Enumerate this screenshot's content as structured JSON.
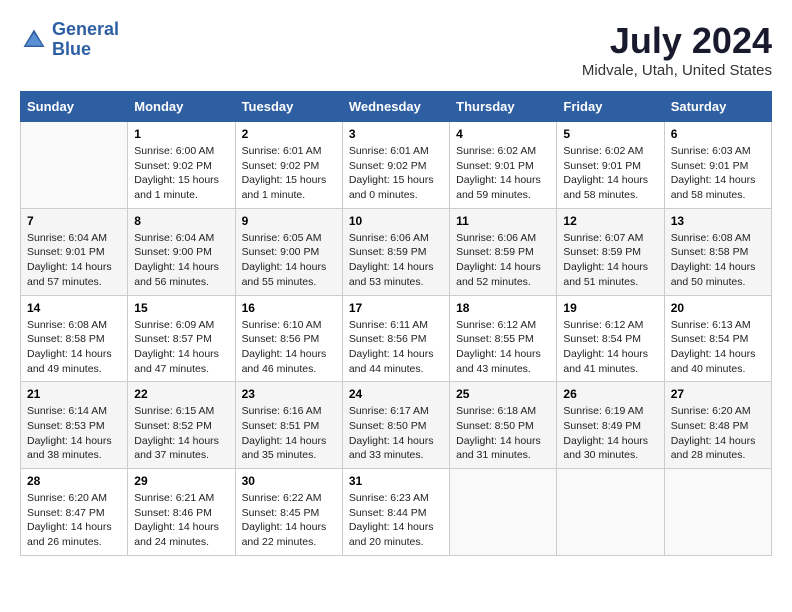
{
  "logo": {
    "line1": "General",
    "line2": "Blue"
  },
  "title": "July 2024",
  "subtitle": "Midvale, Utah, United States",
  "weekdays": [
    "Sunday",
    "Monday",
    "Tuesday",
    "Wednesday",
    "Thursday",
    "Friday",
    "Saturday"
  ],
  "weeks": [
    [
      {
        "day": "",
        "info": ""
      },
      {
        "day": "1",
        "info": "Sunrise: 6:00 AM\nSunset: 9:02 PM\nDaylight: 15 hours\nand 1 minute."
      },
      {
        "day": "2",
        "info": "Sunrise: 6:01 AM\nSunset: 9:02 PM\nDaylight: 15 hours\nand 1 minute."
      },
      {
        "day": "3",
        "info": "Sunrise: 6:01 AM\nSunset: 9:02 PM\nDaylight: 15 hours\nand 0 minutes."
      },
      {
        "day": "4",
        "info": "Sunrise: 6:02 AM\nSunset: 9:01 PM\nDaylight: 14 hours\nand 59 minutes."
      },
      {
        "day": "5",
        "info": "Sunrise: 6:02 AM\nSunset: 9:01 PM\nDaylight: 14 hours\nand 58 minutes."
      },
      {
        "day": "6",
        "info": "Sunrise: 6:03 AM\nSunset: 9:01 PM\nDaylight: 14 hours\nand 58 minutes."
      }
    ],
    [
      {
        "day": "7",
        "info": "Sunrise: 6:04 AM\nSunset: 9:01 PM\nDaylight: 14 hours\nand 57 minutes."
      },
      {
        "day": "8",
        "info": "Sunrise: 6:04 AM\nSunset: 9:00 PM\nDaylight: 14 hours\nand 56 minutes."
      },
      {
        "day": "9",
        "info": "Sunrise: 6:05 AM\nSunset: 9:00 PM\nDaylight: 14 hours\nand 55 minutes."
      },
      {
        "day": "10",
        "info": "Sunrise: 6:06 AM\nSunset: 8:59 PM\nDaylight: 14 hours\nand 53 minutes."
      },
      {
        "day": "11",
        "info": "Sunrise: 6:06 AM\nSunset: 8:59 PM\nDaylight: 14 hours\nand 52 minutes."
      },
      {
        "day": "12",
        "info": "Sunrise: 6:07 AM\nSunset: 8:59 PM\nDaylight: 14 hours\nand 51 minutes."
      },
      {
        "day": "13",
        "info": "Sunrise: 6:08 AM\nSunset: 8:58 PM\nDaylight: 14 hours\nand 50 minutes."
      }
    ],
    [
      {
        "day": "14",
        "info": "Sunrise: 6:08 AM\nSunset: 8:58 PM\nDaylight: 14 hours\nand 49 minutes."
      },
      {
        "day": "15",
        "info": "Sunrise: 6:09 AM\nSunset: 8:57 PM\nDaylight: 14 hours\nand 47 minutes."
      },
      {
        "day": "16",
        "info": "Sunrise: 6:10 AM\nSunset: 8:56 PM\nDaylight: 14 hours\nand 46 minutes."
      },
      {
        "day": "17",
        "info": "Sunrise: 6:11 AM\nSunset: 8:56 PM\nDaylight: 14 hours\nand 44 minutes."
      },
      {
        "day": "18",
        "info": "Sunrise: 6:12 AM\nSunset: 8:55 PM\nDaylight: 14 hours\nand 43 minutes."
      },
      {
        "day": "19",
        "info": "Sunrise: 6:12 AM\nSunset: 8:54 PM\nDaylight: 14 hours\nand 41 minutes."
      },
      {
        "day": "20",
        "info": "Sunrise: 6:13 AM\nSunset: 8:54 PM\nDaylight: 14 hours\nand 40 minutes."
      }
    ],
    [
      {
        "day": "21",
        "info": "Sunrise: 6:14 AM\nSunset: 8:53 PM\nDaylight: 14 hours\nand 38 minutes."
      },
      {
        "day": "22",
        "info": "Sunrise: 6:15 AM\nSunset: 8:52 PM\nDaylight: 14 hours\nand 37 minutes."
      },
      {
        "day": "23",
        "info": "Sunrise: 6:16 AM\nSunset: 8:51 PM\nDaylight: 14 hours\nand 35 minutes."
      },
      {
        "day": "24",
        "info": "Sunrise: 6:17 AM\nSunset: 8:50 PM\nDaylight: 14 hours\nand 33 minutes."
      },
      {
        "day": "25",
        "info": "Sunrise: 6:18 AM\nSunset: 8:50 PM\nDaylight: 14 hours\nand 31 minutes."
      },
      {
        "day": "26",
        "info": "Sunrise: 6:19 AM\nSunset: 8:49 PM\nDaylight: 14 hours\nand 30 minutes."
      },
      {
        "day": "27",
        "info": "Sunrise: 6:20 AM\nSunset: 8:48 PM\nDaylight: 14 hours\nand 28 minutes."
      }
    ],
    [
      {
        "day": "28",
        "info": "Sunrise: 6:20 AM\nSunset: 8:47 PM\nDaylight: 14 hours\nand 26 minutes."
      },
      {
        "day": "29",
        "info": "Sunrise: 6:21 AM\nSunset: 8:46 PM\nDaylight: 14 hours\nand 24 minutes."
      },
      {
        "day": "30",
        "info": "Sunrise: 6:22 AM\nSunset: 8:45 PM\nDaylight: 14 hours\nand 22 minutes."
      },
      {
        "day": "31",
        "info": "Sunrise: 6:23 AM\nSunset: 8:44 PM\nDaylight: 14 hours\nand 20 minutes."
      },
      {
        "day": "",
        "info": ""
      },
      {
        "day": "",
        "info": ""
      },
      {
        "day": "",
        "info": ""
      }
    ]
  ]
}
